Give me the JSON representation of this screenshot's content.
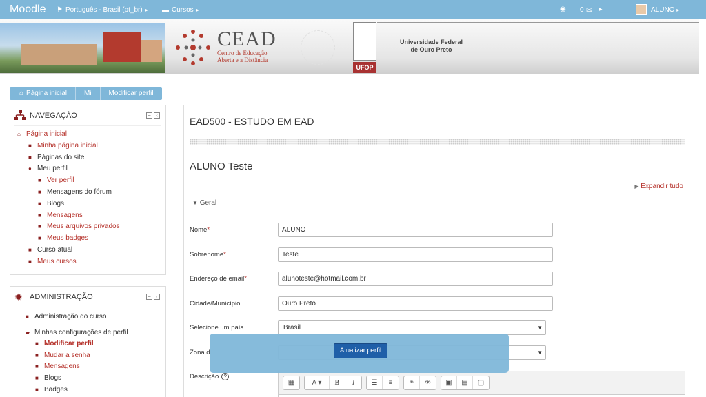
{
  "navbar": {
    "brand": "Moodle",
    "language": "Português - Brasil (pt_br)",
    "courses": "Cursos",
    "message_count": "0",
    "user": "ALUNO"
  },
  "banner": {
    "cead": "CEAD",
    "cead_sub_line1": "Centro de Educação",
    "cead_sub_line2": "Aberta e a Distância",
    "ufop": "UFOP",
    "university_line1": "Universidade Federal",
    "university_line2": "de Ouro Preto"
  },
  "breadcrumb": [
    "Página inicial",
    "Mi",
    "Modificar perfil"
  ],
  "navigation": {
    "title": "NAVEGAÇÃO",
    "items": [
      {
        "label": "Página inicial",
        "level": 0
      },
      {
        "label": "Minha página inicial",
        "level": 1
      },
      {
        "label": "Páginas do site",
        "level": 1
      },
      {
        "label": "Meu perfil",
        "level": 1
      },
      {
        "label": "Ver perfil",
        "level": 2
      },
      {
        "label": "Mensagens do fórum",
        "level": 2
      },
      {
        "label": "Blogs",
        "level": 2
      },
      {
        "label": "Mensagens",
        "level": 2
      },
      {
        "label": "Meus arquivos privados",
        "level": 2
      },
      {
        "label": "Meus badges",
        "level": 2
      },
      {
        "label": "Curso atual",
        "level": 1
      },
      {
        "label": "Meus cursos",
        "level": 1
      }
    ]
  },
  "administration": {
    "title": "ADMINISTRAÇÃO",
    "items": [
      {
        "label": "Administração do curso"
      },
      {
        "label": "Minhas configurações de perfil"
      },
      {
        "label": "Modificar perfil"
      },
      {
        "label": "Mudar a senha"
      },
      {
        "label": "Mensagens"
      },
      {
        "label": "Blogs"
      },
      {
        "label": "Badges"
      }
    ]
  },
  "main": {
    "course_title": "EAD500 - ESTUDO EM EAD",
    "user_title": "ALUNO Teste",
    "expand_all": "Expandir tudo",
    "section": "Geral",
    "fields": {
      "nome_label": "Nome",
      "nome_value": "ALUNO",
      "sobrenome_label": "Sobrenome",
      "sobrenome_value": "Teste",
      "email_label": "Endereço de email",
      "email_value": "alunoteste@hotmail.com.br",
      "cidade_label": "Cidade/Município",
      "cidade_value": "Ouro Preto",
      "pais_label": "Selecione um país",
      "pais_value": "Brasil",
      "zona_label": "Zona d",
      "descricao_label": "Descrição"
    },
    "required_marker": "*"
  },
  "update_button": "Atualizar perfil",
  "colors": {
    "navbar": "#7fb7d9",
    "link_red": "#b5312a",
    "button_blue": "#1f5fa8"
  }
}
